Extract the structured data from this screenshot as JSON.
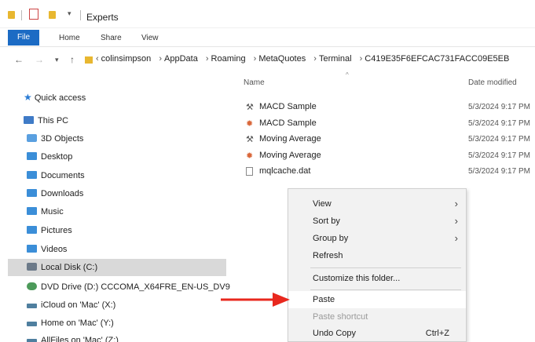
{
  "window": {
    "title": "Experts"
  },
  "ribbon": {
    "tabs": [
      "File",
      "Home",
      "Share",
      "View"
    ]
  },
  "address": {
    "segments": [
      "colinsimpson",
      "AppData",
      "Roaming",
      "MetaQuotes",
      "Terminal",
      "C419E35F6EFCAC731FACC09E5EB"
    ]
  },
  "nav": {
    "items": [
      {
        "label": "Quick access",
        "icon": "star-icon"
      },
      {
        "label": "This PC",
        "icon": "pc-icon"
      },
      {
        "label": "3D Objects",
        "icon": "3d-objects-icon"
      },
      {
        "label": "Desktop",
        "icon": "folder-icon"
      },
      {
        "label": "Documents",
        "icon": "folder-icon"
      },
      {
        "label": "Downloads",
        "icon": "folder-icon"
      },
      {
        "label": "Music",
        "icon": "folder-icon"
      },
      {
        "label": "Pictures",
        "icon": "folder-icon"
      },
      {
        "label": "Videos",
        "icon": "folder-icon"
      },
      {
        "label": "Local Disk (C:)",
        "icon": "disk-icon"
      },
      {
        "label": "DVD Drive (D:) CCCOMA_X64FRE_EN-US_DV9",
        "icon": "dvd-icon"
      },
      {
        "label": "iCloud on 'Mac' (X:)",
        "icon": "network-drive-icon"
      },
      {
        "label": "Home on 'Mac' (Y:)",
        "icon": "network-drive-icon"
      },
      {
        "label": "AllFiles on 'Mac' (Z:)",
        "icon": "network-drive-icon"
      }
    ]
  },
  "filelist": {
    "columns": {
      "name": "Name",
      "date": "Date modified"
    },
    "files": [
      {
        "name": "MACD Sample",
        "date": "5/3/2024 9:17 PM",
        "icon": "mq5-file-icon"
      },
      {
        "name": "MACD Sample",
        "date": "5/3/2024 9:17 PM",
        "icon": "ex5-file-icon"
      },
      {
        "name": "Moving Average",
        "date": "5/3/2024 9:17 PM",
        "icon": "mq5-file-icon"
      },
      {
        "name": "Moving Average",
        "date": "5/3/2024 9:17 PM",
        "icon": "ex5-file-icon"
      },
      {
        "name": "mqlcache.dat",
        "date": "5/3/2024 9:17 PM",
        "icon": "dat-file-icon"
      }
    ]
  },
  "context_menu": {
    "view": "View",
    "sort_by": "Sort by",
    "group_by": "Group by",
    "refresh": "Refresh",
    "customize": "Customize this folder...",
    "paste": "Paste",
    "paste_shortcut": "Paste shortcut",
    "undo_copy": "Undo Copy",
    "undo_shortcut": "Ctrl+Z"
  },
  "colors": {
    "accent": "#1c6bc4",
    "highlight_arrow": "#e8281e",
    "folder": "#e8b730"
  }
}
